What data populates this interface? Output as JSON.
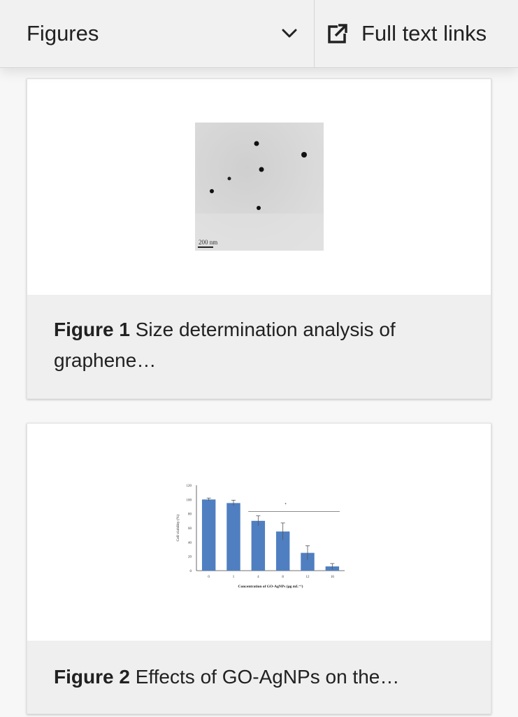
{
  "topbar": {
    "dropdown_label": "Figures",
    "dropdown_icon": "chevron-down-icon",
    "fulltext_label": "Full text links",
    "fulltext_icon": "external-link-icon"
  },
  "figures": [
    {
      "number": "Figure 1",
      "caption": "Size determination analysis of graphene…",
      "thumb_scale_label": "200 nm"
    },
    {
      "number": "Figure 2",
      "caption": "Effects of GO-AgNPs on the…",
      "chart_data": {
        "type": "bar",
        "categories": [
          "0",
          "1",
          "4",
          "8",
          "12",
          "16"
        ],
        "values": [
          100,
          95,
          70,
          55,
          25,
          6
        ],
        "errors": [
          2,
          4,
          7,
          12,
          10,
          4
        ],
        "xlabel": "Concentration of GO-AgNPs (μg mL⁻¹)",
        "ylabel": "Cell viability (%)",
        "ylim": [
          0,
          120
        ],
        "yticks": [
          "0",
          "20",
          "40",
          "60",
          "80",
          "100",
          "120"
        ],
        "significance_marker": "*",
        "bar_color": "#4f7fc1"
      }
    }
  ]
}
